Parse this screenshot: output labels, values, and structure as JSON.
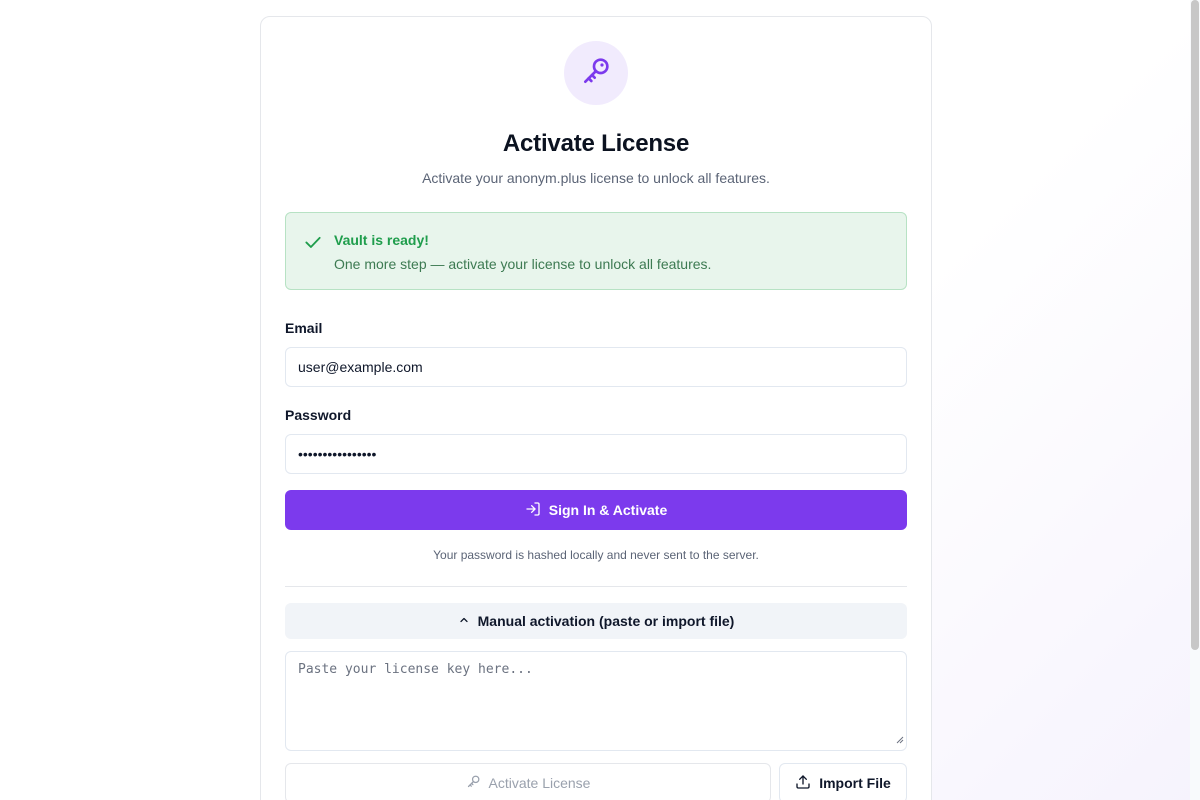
{
  "header": {
    "title": "Activate License",
    "subtitle": "Activate your anonym.plus license to unlock all features.",
    "icon": "key-icon",
    "accent": "#7c3aed"
  },
  "alert": {
    "icon": "check-icon",
    "title": "Vault is ready!",
    "message": "One more step — activate your license to unlock all features.",
    "color": "#1f9d4c"
  },
  "form": {
    "email_label": "Email",
    "email_value": "user@example.com",
    "password_label": "Password",
    "password_value": "••••••••••••••••",
    "submit_label": "Sign In & Activate",
    "submit_icon": "sign-in-icon",
    "hint": "Your password is hashed locally and never sent to the server."
  },
  "manual": {
    "toggle_label": "Manual activation (paste or import file)",
    "toggle_icon": "chevron-up-icon",
    "placeholder": "Paste your license key here...",
    "activate_label": "Activate License",
    "activate_icon": "key-icon",
    "import_label": "Import File",
    "import_icon": "upload-icon"
  }
}
